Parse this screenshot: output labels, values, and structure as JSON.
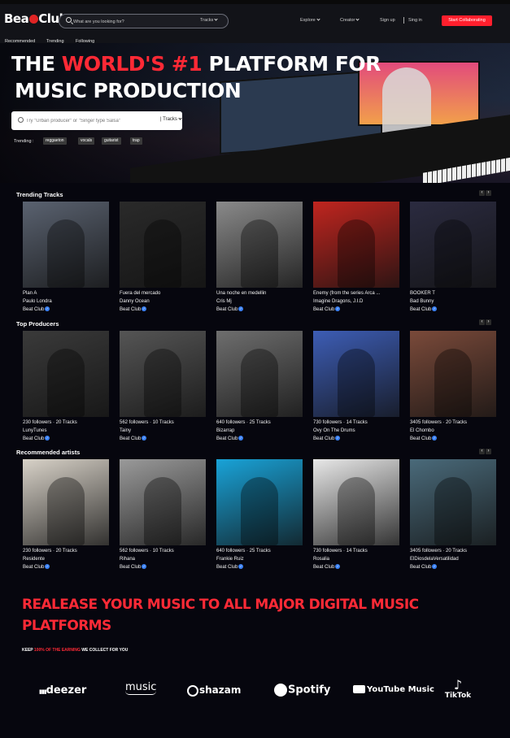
{
  "header": {
    "logo_text_a": "Bea",
    "logo_text_b": "Club",
    "search_placeholder": "What are you looking for?",
    "search_type": "Tracks",
    "nav_explore": "Explore",
    "nav_creator": "Creator",
    "sign_up": "Sign up",
    "sign_in": "Sing in",
    "start_collab": "Start Collaborating"
  },
  "subtabs": [
    "Recommended",
    "Trending",
    "Following"
  ],
  "hero": {
    "line1_a": "THE",
    "line1_b": "WORLD'S #1",
    "line1_c": "PLATFORM FOR",
    "line2": "MUSIC PRODUCTION",
    "search_placeholder": "Try \"Urban producer\" or \"Singer type Salsa\"",
    "search_type": "Tracks",
    "trending_label": "Trending :",
    "trending_tags": [
      "reggaeton",
      "vocals",
      "guitarist",
      "trap"
    ]
  },
  "trending_tracks": {
    "title": "Trending Tracks",
    "items": [
      {
        "title": "Plan A",
        "artist": "Paulo Londra",
        "label": "Beat Club",
        "color": "#5a6270"
      },
      {
        "title": "Fuera del mercado",
        "artist": "Danny Ocean",
        "label": "Beat Club",
        "color": "#2a2a2a"
      },
      {
        "title": "Una noche en medellin",
        "artist": "Cris Mj",
        "label": "Beat Club",
        "color": "#8a8a8a"
      },
      {
        "title": "Enemy (from the series Arca ...",
        "artist": "Imagine Dragons, J.I.D",
        "label": "Beat Club",
        "color": "#c0251f"
      },
      {
        "title": "BOOKER T",
        "artist": "Bad Bunny",
        "label": "Beat Club",
        "color": "#2b2b40"
      }
    ]
  },
  "top_producers": {
    "title": "Top Producers",
    "items": [
      {
        "stats": "230 followers · 20 Tracks",
        "name": "LunyTunes",
        "label": "Beat Club",
        "color": "#3a3a3a"
      },
      {
        "stats": "562 followers · 10 Tracks",
        "name": "Tainy",
        "label": "Beat Club",
        "color": "#555"
      },
      {
        "stats": "640 followers · 25 Tracks",
        "name": "Bizarrap",
        "label": "Beat Club",
        "color": "#6e6e6e"
      },
      {
        "stats": "730 followers · 14 Tracks",
        "name": "Ovy On The Drums",
        "label": "Beat Club",
        "color": "#3d5db5"
      },
      {
        "stats": "3405 followers · 20 Tracks",
        "name": "El Chombo",
        "label": "Beat Club",
        "color": "#7a4a3a"
      }
    ]
  },
  "recommended_artists": {
    "title": "Recommended artists",
    "items": [
      {
        "stats": "230 followers · 20 Tracks",
        "name": "Residente",
        "label": "Beat Club",
        "color": "#d8d2c8"
      },
      {
        "stats": "562 followers · 10 Tracks",
        "name": "Rihana",
        "label": "Beat Club",
        "color": "#9a9a9a"
      },
      {
        "stats": "640 followers · 25 Tracks",
        "name": "Frankie Ruiz",
        "label": "Beat Club",
        "color": "#19a3d8"
      },
      {
        "stats": "730 followers · 14 Tracks",
        "name": "Rosalia",
        "label": "Beat Club",
        "color": "#e8e8e8"
      },
      {
        "stats": "3405 followers · 20 Tracks",
        "name": "ElDiosdelaVersatilidad",
        "label": "Beat Club",
        "color": "#4a6a7a"
      }
    ]
  },
  "release": {
    "line1": "REALEASE YOUR MUSIC TO ALL MAJOR DIGITAL MUSIC",
    "line2": "PLATFORMS",
    "keep_a": "KEEP",
    "keep_b": "100% OF THE EARNING",
    "keep_c": "WE COLLECT FOR YOU"
  },
  "platforms": [
    "deezer",
    "music",
    "shazam",
    "Spotify",
    "YouTube Music",
    "TikTok"
  ]
}
